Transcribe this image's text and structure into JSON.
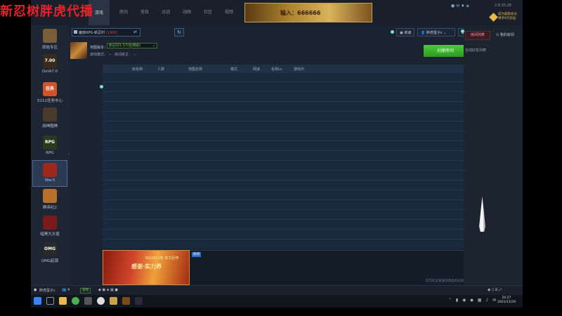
{
  "overlay": {
    "title": "新忍树胖虎代播"
  },
  "nav": {
    "tabs": [
      "游戏",
      "房间",
      "竞技",
      "对战",
      "战网",
      "社区",
      "视频"
    ],
    "active_index": 0
  },
  "banner": {
    "text": "输入：666666"
  },
  "window": {
    "version": "2.8.35.28"
  },
  "vip": {
    "line1": "成为超级会员",
    "line2": "尊享8元权益"
  },
  "sidebar": {
    "games": [
      {
        "label": "原始专区",
        "icon_text": "",
        "color": "#7a5e3a"
      },
      {
        "label": "DotA7.0",
        "icon_text": "7.00",
        "color": "#3a2a1c"
      },
      {
        "label": "5211任务中心",
        "icon_text": "任务",
        "color": "#d4542a"
      },
      {
        "label": "战神围棋",
        "icon_text": "",
        "color": "#4a3a2c"
      },
      {
        "label": "RPG",
        "icon_text": "RPG",
        "color": "#2a3a1c"
      },
      {
        "label": "War3",
        "icon_text": "",
        "color": "#a0281a"
      },
      {
        "label": "群英纪2",
        "icon_text": "",
        "color": "#b8702a"
      },
      {
        "label": "暗黑大天使",
        "icon_text": "",
        "color": "#7a1a1a"
      },
      {
        "label": "OMG起源",
        "icon_text": "OMG",
        "color": "#2a2a2a"
      }
    ],
    "active_index": 5
  },
  "room": {
    "prefix": "魔兽RPG-新忍村",
    "highlight": "(1300)"
  },
  "map": {
    "label": "地图版本：",
    "selected": "新忍村1.57(经典版)",
    "info_label": "游戏模式：",
    "info_value": "--",
    "host_label": "房间房主：",
    "host_value": "--"
  },
  "actions": {
    "ping": "房速",
    "user": "胖虎蛋子c",
    "quit": "退出",
    "create": "创建房间"
  },
  "table": {
    "headers": [
      "房名称",
      "人数",
      "地图名称",
      "模式",
      "网速",
      "名称Lv",
      "游戏中"
    ]
  },
  "chat": {
    "tab": "房间",
    "hint": "您可在此发送消息给房间成员哦"
  },
  "ad": {
    "title": "SS/2021年 实力巨作",
    "text": "感谢·实力养"
  },
  "right_panel": {
    "tab_active": "房间列表",
    "tab_other": "我的房间",
    "friends_label": "在线好友列表"
  },
  "status_bar": {
    "user": "胖虎蛋子c",
    "count": "4",
    "box_label": "游戏"
  },
  "clock": {
    "time": "20:27",
    "date": "2021/11/29"
  }
}
